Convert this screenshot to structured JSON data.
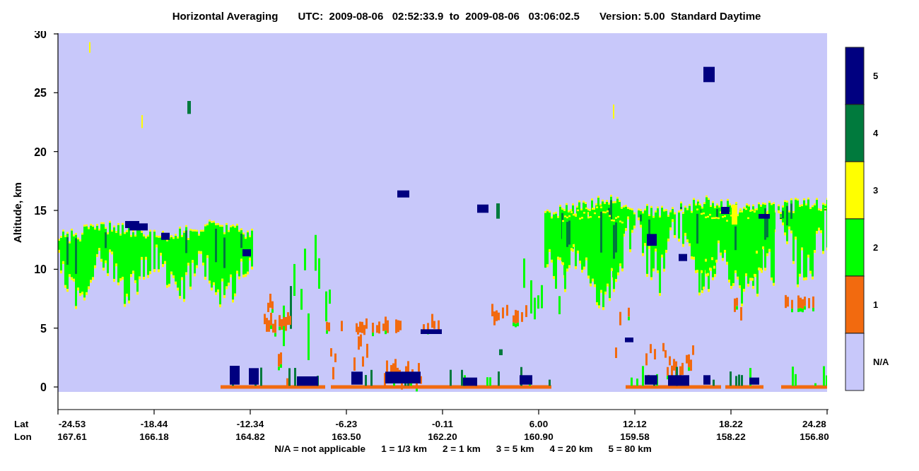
{
  "title": {
    "parts": [
      "Horizontal Averaging",
      "UTC:  2009-08-06   02:52:33.9  to  2009-08-06   03:06:02.5",
      "Version: 5.00  Standard Daytime"
    ]
  },
  "y_axis": {
    "label": "Altitude, km",
    "ticks": [
      "30",
      "25",
      "20",
      "15",
      "10",
      "5",
      "0"
    ]
  },
  "x_axis": {
    "rows": [
      {
        "label": "Lat",
        "ticks": [
          "-24.53",
          "-18.44",
          "-12.34",
          "-6.23",
          "-0.11",
          "6.00",
          "12.12",
          "18.22",
          "24.28"
        ]
      },
      {
        "label": "Lon",
        "ticks": [
          "167.61",
          "166.18",
          "164.82",
          "163.50",
          "162.20",
          "160.90",
          "159.58",
          "158.22",
          "156.80"
        ]
      }
    ]
  },
  "colorbar": [
    {
      "label": "5",
      "color": "#000080"
    },
    {
      "label": "4",
      "color": "#007a3d"
    },
    {
      "label": "3",
      "color": "#ffff00"
    },
    {
      "label": "2",
      "color": "#00ff00"
    },
    {
      "label": "1",
      "color": "#f26a0f"
    },
    {
      "label": "N/A",
      "color": "#c8c8fa"
    }
  ],
  "legend": [
    "N/A = not applicable",
    "1 = 1/3 km",
    "2 = 1 km",
    "3 = 5 km",
    "4 = 20 km",
    "5 = 80 km"
  ]
}
